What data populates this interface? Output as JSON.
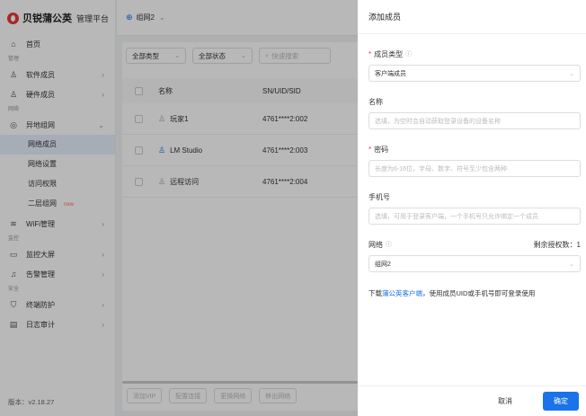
{
  "brand": {
    "name": "贝锐蒲公英",
    "subtitle": "管理平台"
  },
  "sidebar": {
    "home": "首页",
    "group_manage": "管理",
    "software_member": "软件成员",
    "hardware_member": "硬件成员",
    "group_network": "网络",
    "hetero_network": "异地组网",
    "sub_items": [
      "网络成员",
      "网络设置",
      "访问权限",
      "二层组网"
    ],
    "new_badge": "new",
    "wifi": "WiFi管理",
    "group_monitor": "监控",
    "monitor_screen": "监控大屏",
    "alert": "告警管理",
    "group_security": "安全",
    "terminal": "终端防护",
    "audit": "日志审计",
    "version": "版本：v2.18.27"
  },
  "topbar": {
    "group": "组网2"
  },
  "main": {
    "filter_type": "全部类型",
    "filter_status": "全部状态",
    "search_placeholder": "快速搜索",
    "col_name": "名称",
    "col_sn": "SN/UID/SID",
    "rows": [
      {
        "name": "玩家1",
        "sn": "4761****2:002"
      },
      {
        "name": "LM Studio",
        "sn": "4761****2:003"
      },
      {
        "name": "远程访问",
        "sn": "4761****2:004"
      }
    ],
    "buttons": [
      "添加VIP",
      "配置连接",
      "更换网络",
      "移出网络"
    ]
  },
  "drawer": {
    "title": "添加成员",
    "member_type_label": "成员类型",
    "member_type_value": "客户端成员",
    "name_label": "名称",
    "name_placeholder": "选填，为空时会自动获取登录设备的设备名称",
    "password_label": "密码",
    "password_placeholder": "长度为6-16位，字母、数字、符号至少包含两种",
    "phone_label": "手机号",
    "phone_placeholder": "选填，可用于登录客户端，一个手机号只允许绑定一个成员",
    "network_label": "网络",
    "quota_text": "剩余授权数：1",
    "network_value": "组网2",
    "note_prefix": "下载",
    "note_link": "蒲公英客户端",
    "note_suffix": "，使用成员UID或手机号即可登录使用",
    "cancel": "取消",
    "confirm": "确定"
  }
}
